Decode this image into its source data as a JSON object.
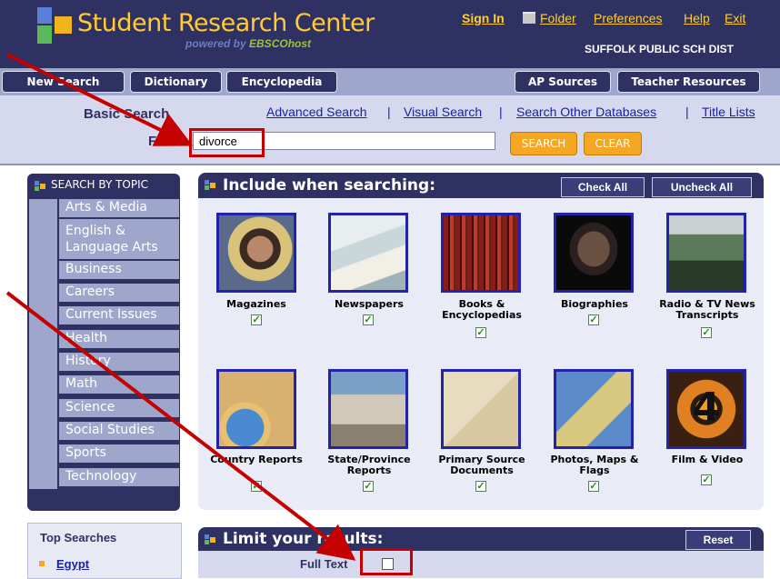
{
  "header": {
    "title": "Student Research Center",
    "subtitle_prefix": "powered by ",
    "subtitle_brand": "EBSCOhost",
    "district": "SUFFOLK PUBLIC SCH DIST",
    "links": {
      "sign_in": "Sign In",
      "folder": "Folder",
      "preferences": "Preferences",
      "help": "Help",
      "exit": "Exit"
    }
  },
  "nav": {
    "new_search": "New Search",
    "dictionary": "Dictionary",
    "encyclopedia": "Encyclopedia",
    "ap_sources": "AP Sources",
    "teacher_resources": "Teacher Resources"
  },
  "search": {
    "mode": "Basic Search",
    "links": {
      "advanced": "Advanced Search",
      "visual": "Visual Search",
      "other_db": "Search Other Databases",
      "title_lists": "Title Lists"
    },
    "separator": "|",
    "find_label": "Find:",
    "query": "divorce",
    "search_btn": "SEARCH",
    "clear_btn": "CLEAR"
  },
  "sidebar": {
    "header": "SEARCH BY TOPIC",
    "topics": [
      "Arts & Media",
      "English & Language Arts",
      "Business",
      "Careers",
      "Current Issues",
      "Health",
      "History",
      "Math",
      "Science",
      "Social Studies",
      "Sports",
      "Technology"
    ],
    "top_searches_title": "Top Searches",
    "top_searches": [
      "Egypt"
    ]
  },
  "include": {
    "title": "Include when searching:",
    "check_all": "Check All",
    "uncheck_all": "Uncheck All",
    "sources": [
      {
        "label": "Magazines",
        "checked": true
      },
      {
        "label": "Newspapers",
        "checked": true
      },
      {
        "label": "Books & Encyclopedias",
        "checked": true
      },
      {
        "label": "Biographies",
        "checked": true
      },
      {
        "label": "Radio & TV News Transcripts",
        "checked": true
      },
      {
        "label": "Country Reports",
        "checked": true
      },
      {
        "label": "State/Province Reports",
        "checked": true
      },
      {
        "label": "Primary Source Documents",
        "checked": true
      },
      {
        "label": "Photos, Maps & Flags",
        "checked": true
      },
      {
        "label": "Film & Video",
        "checked": true
      }
    ]
  },
  "limit": {
    "title": "Limit your results:",
    "reset": "Reset",
    "full_text_label": "Full Text",
    "full_text_checked": false
  },
  "colors": {
    "navy": "#2f3163",
    "accent": "#ffcc33",
    "button_orange": "#f5a623",
    "annotation_red": "#c40000"
  }
}
